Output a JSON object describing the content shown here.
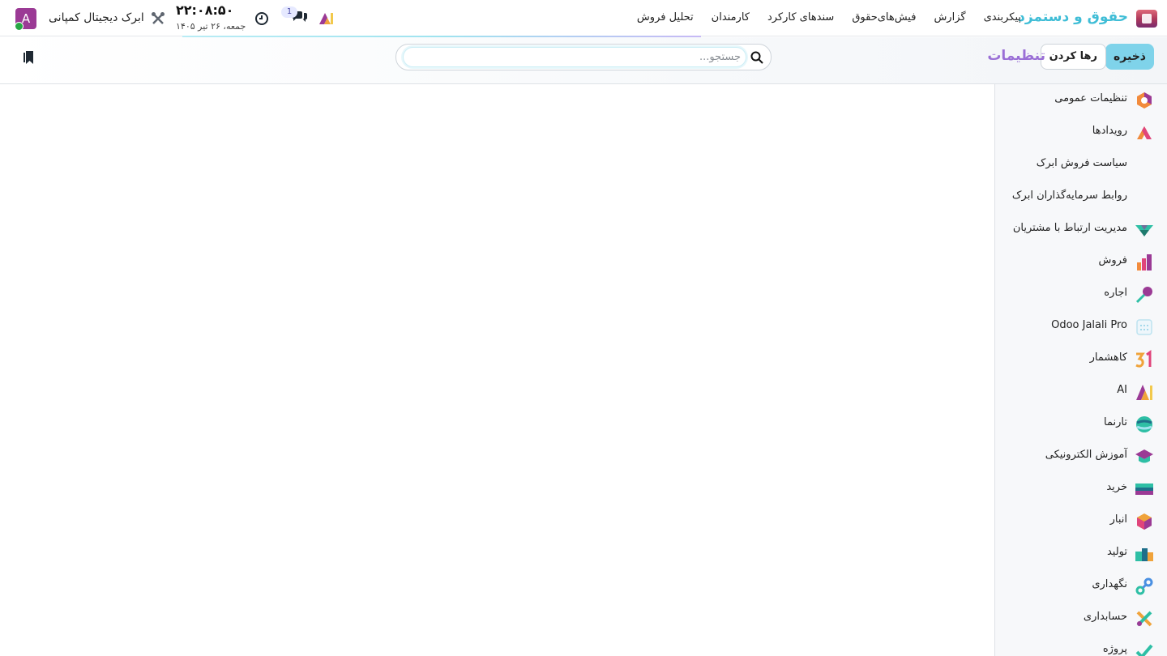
{
  "navbar": {
    "brand": "حقوق و دستمزد",
    "menu": [
      "تحلیل فروش",
      "کارمندان",
      "سندهای کارکرد",
      "فیش‌های‌حقوق",
      "گزارش",
      "پیکربندی"
    ],
    "chat_count": "1",
    "time": "۲۲:۰۸:۵۰",
    "date": "جمعه، ۲۶ تیر ۱۴۰۵",
    "company": "ابرک دیجیتال کمپانی",
    "avatar_letter": "A"
  },
  "control": {
    "save_label": "ذخیره",
    "discard_label": "رها کردن",
    "title": "تنظیمات",
    "search_placeholder": "جستجو..."
  },
  "sidebar": {
    "items": [
      {
        "label": "تنظیمات عمومی",
        "icon": "general-settings-icon"
      },
      {
        "label": "رویدادها",
        "icon": "events-icon"
      },
      {
        "label": "سیاست فروش ابرک",
        "icon": ""
      },
      {
        "label": "روابط سرمایه‌گذاران ابرک",
        "icon": ""
      },
      {
        "label": "مدیریت ارتباط با مشتریان",
        "icon": "crm-icon"
      },
      {
        "label": "فروش",
        "icon": "sales-icon"
      },
      {
        "label": "اجاره",
        "icon": "rental-icon"
      },
      {
        "label": "Odoo Jalali Pro",
        "icon": "calendar-grid-icon"
      },
      {
        "label": "کاهشمار",
        "icon": "kahshomar-icon"
      },
      {
        "label": "AI",
        "icon": "ai-icon"
      },
      {
        "label": "تارنما",
        "icon": "website-icon"
      },
      {
        "label": "آموزش الکترونیکی",
        "icon": "elearning-icon"
      },
      {
        "label": "خرید",
        "icon": "purchase-icon"
      },
      {
        "label": "انبار",
        "icon": "inventory-icon"
      },
      {
        "label": "تولید",
        "icon": "manufacturing-icon"
      },
      {
        "label": "نگهداری",
        "icon": "maintenance-icon"
      },
      {
        "label": "حسابداری",
        "icon": "accounting-icon"
      },
      {
        "label": "پروژه",
        "icon": "project-icon"
      }
    ]
  },
  "colors": {
    "brand": "#3fbdd6",
    "title": "#9a6fd6",
    "save_button": "#7fd3ea",
    "avatar": "#9b3a95"
  }
}
